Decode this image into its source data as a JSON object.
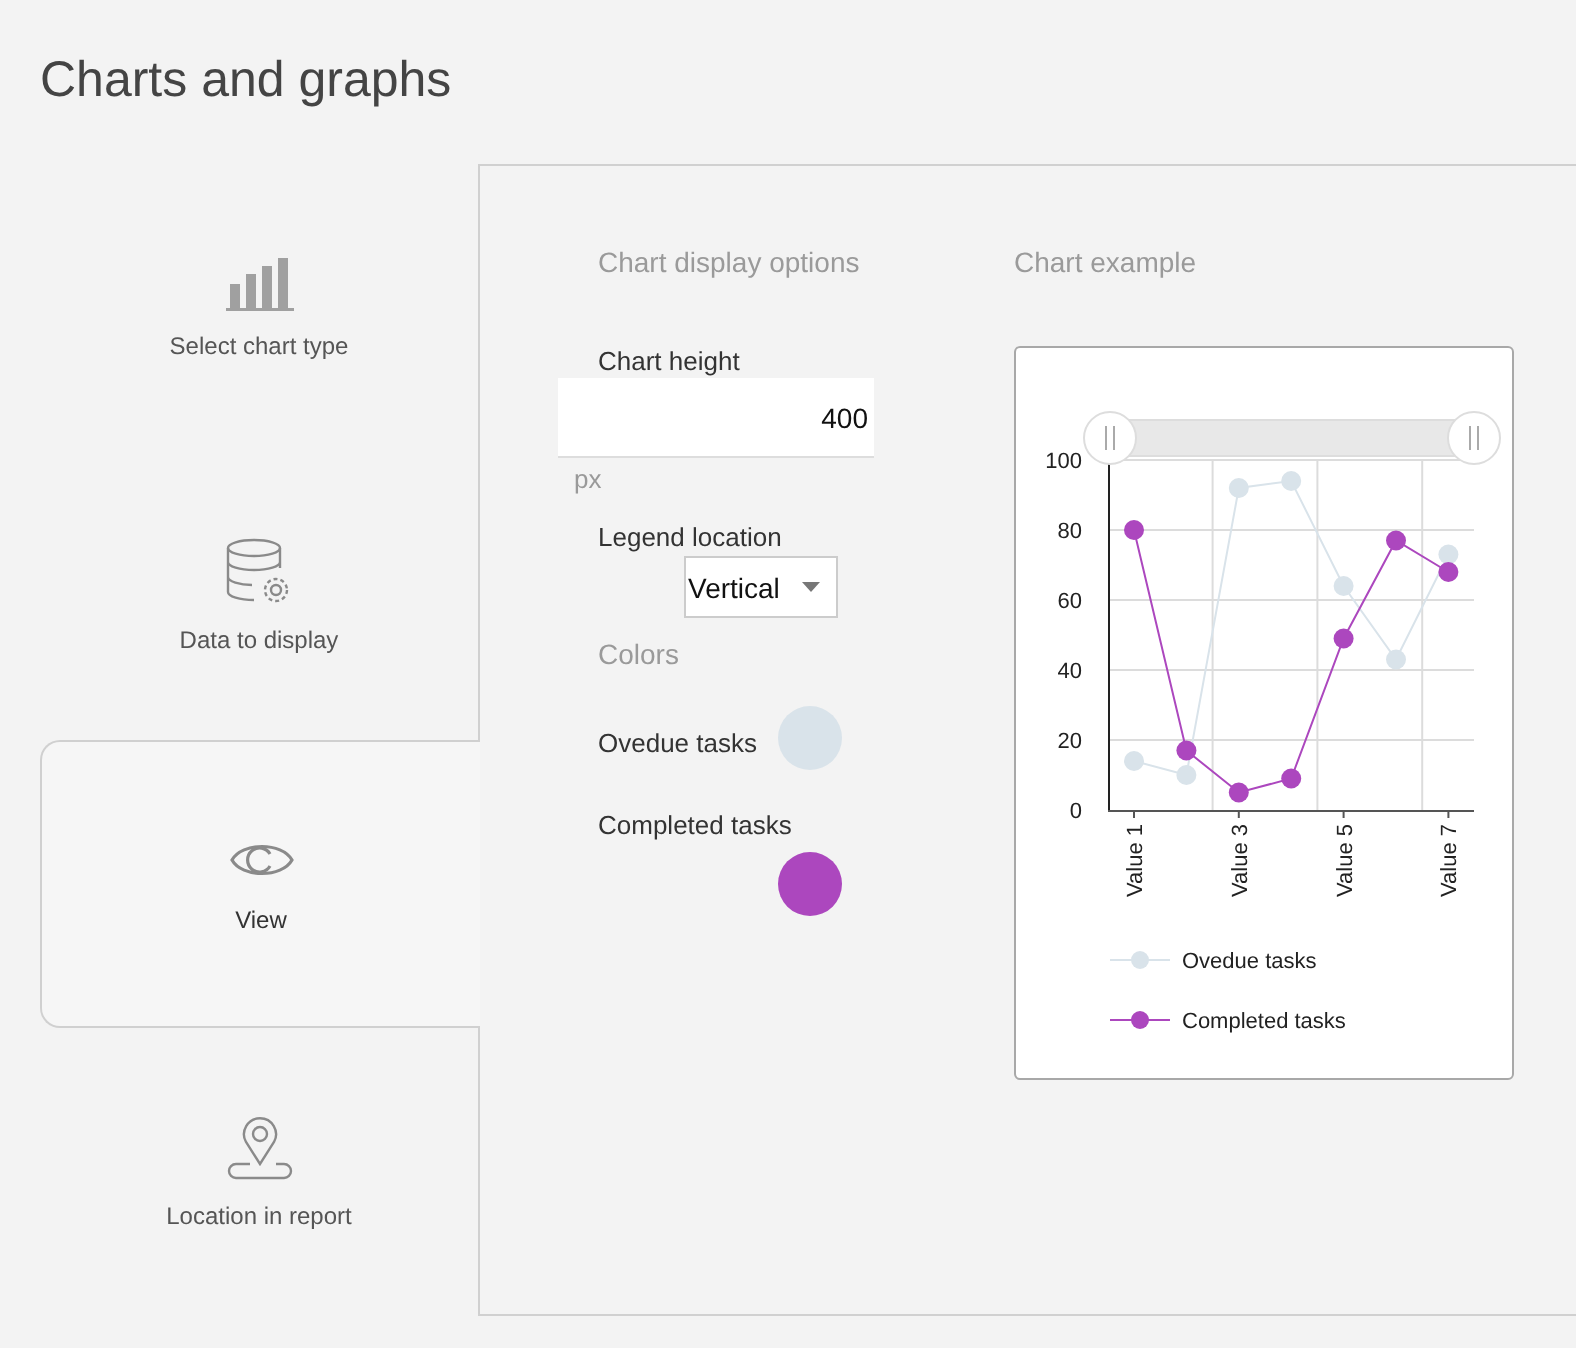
{
  "page_title": "Charts and graphs",
  "steps": [
    {
      "label": "Select chart type",
      "selected": false
    },
    {
      "label": "Data to display",
      "selected": false
    },
    {
      "label": "View",
      "selected": true
    },
    {
      "label": "Location in report",
      "selected": false
    }
  ],
  "options": {
    "heading": "Chart display options",
    "height_label": "Chart height",
    "height_value": "400",
    "height_unit": "px",
    "legend_label": "Legend location",
    "legend_value": "Vertical",
    "colors_heading": "Colors",
    "colors": [
      {
        "label": "Ovedue tasks",
        "color": "#d9e3ea"
      },
      {
        "label": "Completed tasks",
        "color": "#ac47be"
      }
    ]
  },
  "example": {
    "heading": "Chart example",
    "chart_data": {
      "type": "line",
      "categories": [
        "Value 1",
        null,
        "Value 3",
        null,
        "Value 5",
        null,
        "Value 7"
      ],
      "grid": true,
      "legend": "bottom",
      "ylim": [
        0,
        100
      ],
      "yticks": [
        0,
        20,
        40,
        60,
        80,
        100
      ],
      "series": [
        {
          "name": "Ovedue tasks",
          "color": "#d9e3ea",
          "marker": "circle",
          "values": [
            14,
            10,
            92,
            94,
            64,
            43,
            73
          ]
        },
        {
          "name": "Completed tasks",
          "color": "#ac47be",
          "marker": "circle",
          "values": [
            80,
            17,
            5,
            9,
            49,
            77,
            68
          ]
        }
      ]
    }
  }
}
